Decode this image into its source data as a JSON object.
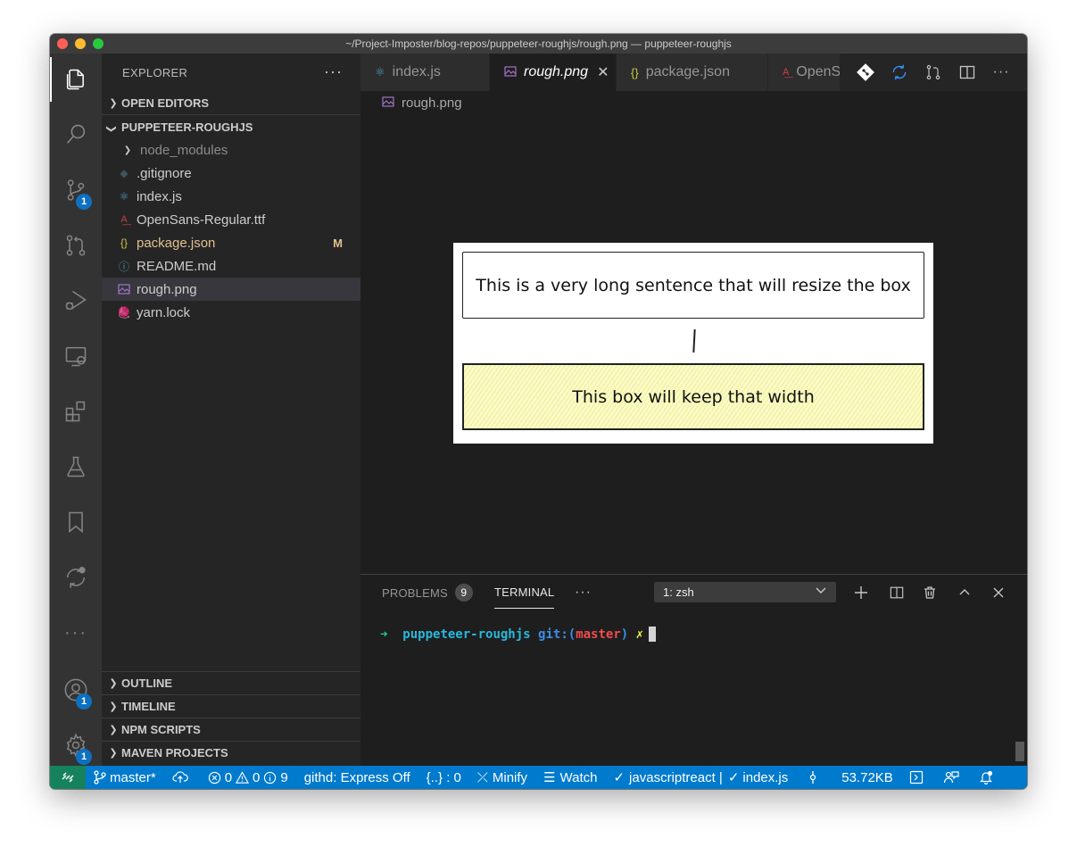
{
  "window": {
    "title": "~/Project-Imposter/blog-repos/puppeteer-roughjs/rough.png — puppeteer-roughjs"
  },
  "activity_bar": {
    "items": [
      {
        "name": "explorer",
        "badge": ""
      },
      {
        "name": "search",
        "badge": ""
      },
      {
        "name": "source-control",
        "badge": "1"
      },
      {
        "name": "pull-requests",
        "badge": ""
      },
      {
        "name": "run-debug",
        "badge": ""
      },
      {
        "name": "remote-explorer",
        "badge": ""
      },
      {
        "name": "extensions",
        "badge": ""
      },
      {
        "name": "testing",
        "badge": ""
      },
      {
        "name": "bookmarks",
        "badge": ""
      },
      {
        "name": "githd",
        "badge": ""
      },
      {
        "name": "more",
        "badge": ""
      }
    ],
    "accounts_badge": "1",
    "settings_badge": "1"
  },
  "sidebar": {
    "header": "EXPLORER",
    "more": "···",
    "open_editors": "OPEN EDITORS",
    "project": "PUPPETEER-ROUGHJS",
    "files": [
      {
        "name": "node_modules",
        "icon": "folder",
        "dim": true
      },
      {
        "name": ".gitignore",
        "icon": "git"
      },
      {
        "name": "index.js",
        "icon": "react"
      },
      {
        "name": "OpenSans-Regular.ttf",
        "icon": "font"
      },
      {
        "name": "package.json",
        "icon": "json",
        "status": "M"
      },
      {
        "name": "README.md",
        "icon": "info"
      },
      {
        "name": "rough.png",
        "icon": "image",
        "selected": true
      },
      {
        "name": "yarn.lock",
        "icon": "yarn"
      }
    ],
    "bottom_sections": [
      "OUTLINE",
      "TIMELINE",
      "NPM SCRIPTS",
      "MAVEN PROJECTS"
    ]
  },
  "tabs": [
    {
      "label": "index.js",
      "icon": "react"
    },
    {
      "label": "rough.png",
      "icon": "image",
      "active": true,
      "close": "✕"
    },
    {
      "label": "package.json",
      "icon": "json"
    },
    {
      "label": "OpenS",
      "icon": "font"
    }
  ],
  "breadcrumb": {
    "label": "rough.png"
  },
  "image_preview": {
    "box1_text": "This is a very long sentence that will resize the box",
    "box2_text": "This box will keep that width",
    "box2_fill": "#f5f4a2"
  },
  "panel": {
    "problems_label": "PROBLEMS",
    "problems_count": "9",
    "terminal_label": "TERMINAL",
    "more": "···",
    "terminal_select": "1: zsh",
    "prompt": {
      "arrow": "➜",
      "dir": "puppeteer-roughjs",
      "git_prefix": "git:(",
      "branch": "master",
      "git_suffix": ")",
      "dirty": "✗"
    }
  },
  "status_bar": {
    "branch": "master*",
    "errors": "0",
    "warnings": "0",
    "infos": "9",
    "githd": "githd: Express Off",
    "braces": "{..} : 0",
    "minify": "Minify",
    "watch": "Watch",
    "lang": "javascriptreact |",
    "file": "index.js",
    "size": "53.72KB"
  },
  "colors": {
    "status_bar": "#007acc",
    "remote": "#16825d",
    "prompt_arrow": "#23d18b",
    "prompt_dir": "#29b8db",
    "prompt_git": "#3b8eea",
    "prompt_branch": "#f14c4c",
    "prompt_dirty": "#f5f543"
  }
}
